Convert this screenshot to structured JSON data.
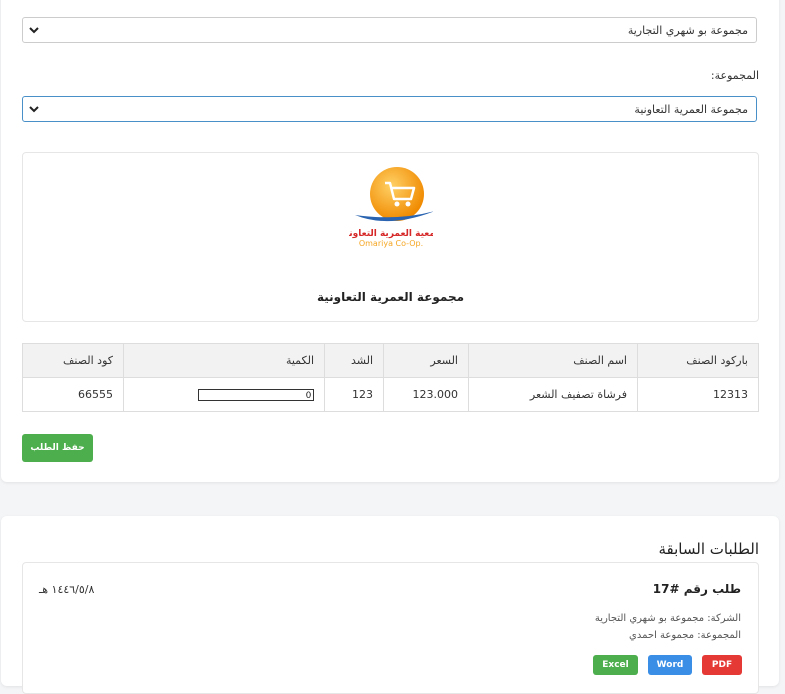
{
  "form": {
    "company_select_value": "مجموعة بو شهري التجارية",
    "group_label": "المجموعة:",
    "group_select_value": "مجموعة العمرية التعاونية"
  },
  "logo": {
    "arabic_text": "جمعية العمرية التعاونية",
    "english_text": "Omariya Co-Op.",
    "caption": "مجموعة العمرية التعاونية",
    "colors": {
      "orange": "#f5a623",
      "blue": "#2a64b0",
      "red": "#d62828"
    }
  },
  "items_table": {
    "headers": [
      "باركود الصنف",
      "اسم الصنف",
      "السعر",
      "الشد",
      "الكمية",
      "كود الصنف"
    ],
    "rows": [
      {
        "barcode": "12313",
        "name": "فرشاة تصفيف الشعر",
        "price": "123.000",
        "pack": "123",
        "qty": "0",
        "code": "66555"
      }
    ]
  },
  "save_button_label": "حفظ الطلب",
  "previous_orders": {
    "title": "الطلبات السابقة",
    "orders": [
      {
        "title": "طلب رقم #17",
        "date": "١٤٤٦/٥/٨ هـ",
        "company_line": "الشركة: مجموعة بو شهري التجارية",
        "group_line": "المجموعة: مجموعة احمدي",
        "buttons": {
          "excel": "Excel",
          "word": "Word",
          "pdf": "PDF"
        }
      }
    ]
  }
}
